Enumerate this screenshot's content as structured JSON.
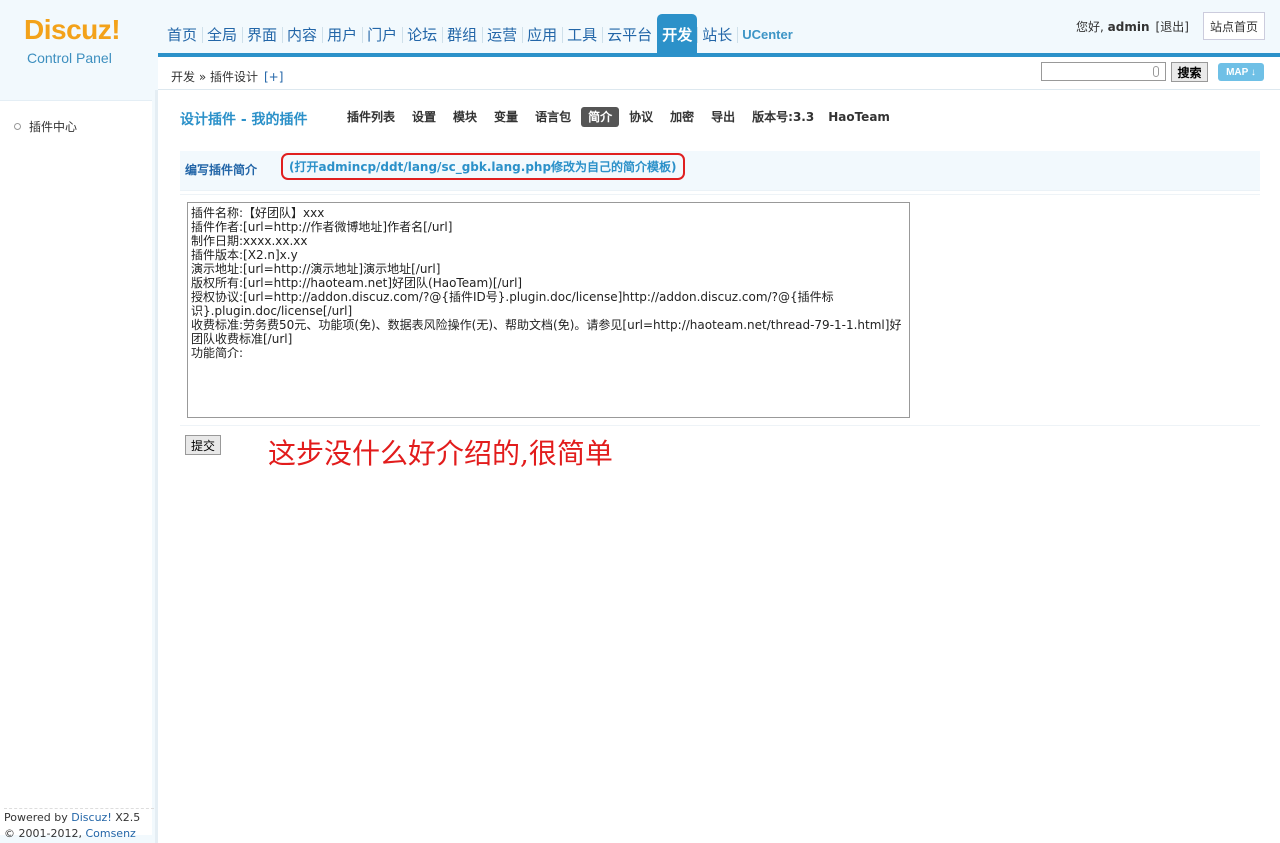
{
  "logo": {
    "brand": "Discuz!",
    "subtitle": "Control Panel"
  },
  "nav": {
    "items": [
      "首页",
      "全局",
      "界面",
      "内容",
      "用户",
      "门户",
      "论坛",
      "群组",
      "运营",
      "应用",
      "工具",
      "云平台",
      "开发",
      "站长",
      "UCenter"
    ],
    "active": "开发"
  },
  "user": {
    "greeting": "您好,",
    "name": "admin",
    "logout": "[退出]",
    "site_home": "站点首页"
  },
  "breadcrumb": {
    "path": "开发 » 插件设计",
    "plus": "[+]"
  },
  "search": {
    "button": "搜索",
    "map_button": "MAP ↓"
  },
  "sidebar": {
    "items": [
      {
        "label": "插件中心"
      }
    ]
  },
  "footer": {
    "powered": "Powered by",
    "brand": "Discuz!",
    "version": "X2.5",
    "copyright": "© 2001-2012,",
    "company": "Comsenz Inc."
  },
  "main": {
    "title": "设计插件 - 我的插件",
    "tabs": [
      {
        "label": "插件列表"
      },
      {
        "label": "设置"
      },
      {
        "label": "模块"
      },
      {
        "label": "变量"
      },
      {
        "label": "语言包"
      },
      {
        "label": "简介",
        "active": true
      },
      {
        "label": "协议"
      },
      {
        "label": "加密"
      },
      {
        "label": "导出"
      },
      {
        "label": "版本号:3.3"
      },
      {
        "label": "HaoTeam"
      }
    ],
    "section_label": "编写插件简介",
    "section_hint": "(打开admincp/ddt/lang/sc_gbk.lang.php修改为自己的简介模板)",
    "textarea_value": "插件名称:【好团队】xxx\n插件作者:[url=http://作者微博地址]作者名[/url]\n制作日期:xxxx.xx.xx\n插件版本:[X2.n]x.y\n演示地址:[url=http://演示地址]演示地址[/url]\n版权所有:[url=http://haoteam.net]好团队(HaoTeam)[/url]\n授权协议:[url=http://addon.discuz.com/?@{插件ID号}.plugin.doc/license]http://addon.discuz.com/?@{插件标识}.plugin.doc/license[/url]\n收费标准:劳务费50元、功能项(免)、数据表风险操作(无)、帮助文档(免)。请参见[url=http://haoteam.net/thread-79-1-1.html]好团队收费标准[/url]\n功能简介:",
    "submit": "提交",
    "annotation": "这步没什么好介绍的,很简单"
  },
  "colors": {
    "accent": "#2c91c9",
    "link": "#2366a8",
    "logo": "#f3a21a",
    "annotation": "#e21c1c"
  }
}
